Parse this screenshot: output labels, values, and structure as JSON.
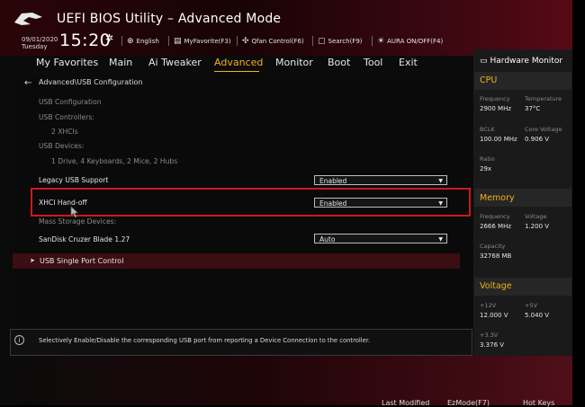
{
  "header": {
    "title": "UEFI BIOS Utility – Advanced Mode",
    "date": "09/01/2020",
    "day": "Tuesday",
    "time": "15:20",
    "buttons": [
      {
        "label": "English",
        "icon": "globe-icon"
      },
      {
        "label": "MyFavorite(F3)",
        "icon": "favorite-icon"
      },
      {
        "label": "Qfan Control(F6)",
        "icon": "fan-icon"
      },
      {
        "label": "Search(F9)",
        "icon": "search-icon"
      },
      {
        "label": "AURA ON/OFF(F4)",
        "icon": "aura-icon"
      }
    ]
  },
  "menu": {
    "items": [
      "My Favorites",
      "Main",
      "Ai Tweaker",
      "Advanced",
      "Monitor",
      "Boot",
      "Tool",
      "Exit"
    ],
    "active": "Advanced"
  },
  "main": {
    "breadcrumb": "Advanced\\USB Configuration",
    "usb_configuration": "USB Configuration",
    "usb_controllers_label": "USB Controllers:",
    "usb_controllers_value": "2 XHCIs",
    "usb_devices_label": "USB Devices:",
    "usb_devices_value": "1 Drive, 4 Keyboards, 2 Mice, 2 Hubs",
    "legacy_label": "Legacy USB Support",
    "legacy_value": "Enabled",
    "xhci_label": "XHCI Hand-off",
    "xhci_value": "Enabled",
    "mass_storage_label": "Mass Storage Devices:",
    "sandisk_label": "SanDisk Cruzer Blade 1.27",
    "sandisk_value": "Auto",
    "single_port": "USB Single Port Control"
  },
  "help": {
    "text": "Selectively Enable/Disable the corresponding USB port from reporting a Device Connection to the controller."
  },
  "hw": {
    "title": "Hardware Monitor",
    "cpu": {
      "label": "CPU",
      "frequency_k": "Frequency",
      "frequency_v": "2900 MHz",
      "temperature_k": "Temperature",
      "temperature_v": "37°C",
      "bclk_k": "BCLK",
      "bclk_v": "100.00 MHz",
      "core_voltage_k": "Core Voltage",
      "core_voltage_v": "0.906 V",
      "ratio_k": "Ratio",
      "ratio_v": "29x"
    },
    "memory": {
      "label": "Memory",
      "frequency_k": "Frequency",
      "frequency_v": "2666 MHz",
      "voltage_k": "Voltage",
      "voltage_v": "1.200 V",
      "capacity_k": "Capacity",
      "capacity_v": "32768 MB"
    },
    "voltage": {
      "label": "Voltage",
      "v12_k": "+12V",
      "v12_v": "12.000 V",
      "v5_k": "+5V",
      "v5_v": "5.040 V",
      "v33_k": "+3.3V",
      "v33_v": "3.376 V"
    }
  },
  "bottom": {
    "last_modified": "Last Modified",
    "ezmode": "EzMode(F7)",
    "hotkeys": "Hot Keys"
  },
  "colors": {
    "accent": "#f2b01e",
    "highlight_border": "#d01818"
  }
}
